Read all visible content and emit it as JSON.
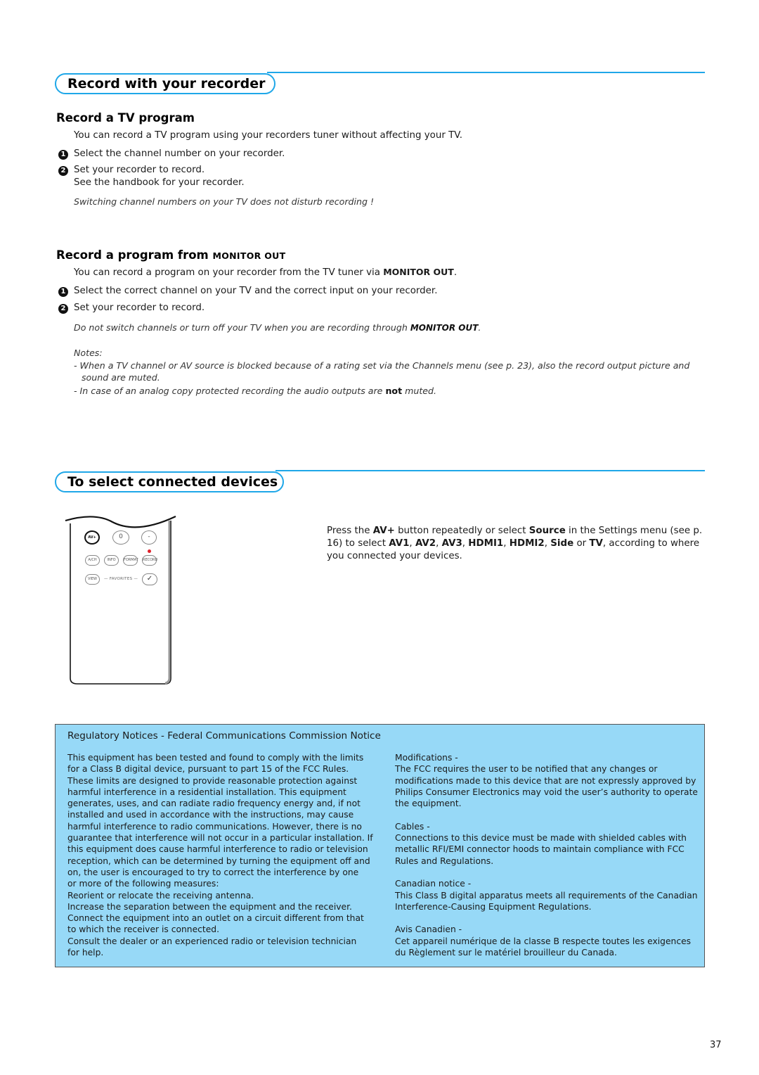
{
  "sections": {
    "record": {
      "title": "Record with your recorder",
      "tv_program": {
        "title": "Record a TV program",
        "intro": "You can record a TV program using your recorders tuner without affecting your TV.",
        "steps": [
          {
            "num": "1",
            "text": "Select the channel number on your recorder."
          },
          {
            "num": "2",
            "text": "Set your recorder to record.",
            "extra": "See the handbook for your recorder."
          }
        ],
        "note": "Switching channel numbers on your TV does not disturb recording !"
      },
      "monitor_out": {
        "title_prefix": "Record a program from",
        "title_emph": "MONITOR OUT",
        "intro_prefix": "You can record a program on your recorder from the TV tuner via",
        "intro_emph": "MONITOR OUT",
        "intro_suffix": ".",
        "steps": [
          {
            "num": "1",
            "text": "Select the correct channel on your TV and the correct input on your recorder."
          },
          {
            "num": "2",
            "text": "Set your recorder to record."
          }
        ],
        "warning_prefix": "Do not switch channels or turn off your TV when you are recording through",
        "warning_emph": "MONITOR OUT",
        "warning_suffix": ".",
        "notes_label": "Notes:",
        "notes": [
          {
            "line1": "- When a TV channel or AV source is blocked because of a rating set via the Channels menu (see p. 23), also the record output picture and",
            "line2": "sound are muted."
          },
          {
            "prefix": "- In case of an analog copy protected recording the audio outputs are",
            "emph": "not",
            "suffix": "muted."
          }
        ]
      }
    },
    "devices": {
      "title": "To select connected devices",
      "desc": {
        "l1_a": "Press the",
        "l1_b": "AV+",
        "l1_c": "button repeatedly or select",
        "l1_d": "Source",
        "l1_e": "in the Settings menu (see p.",
        "l2_a": "16) to select",
        "l2_b": "AV1",
        "l2_c": ",",
        "l2_d": "AV2",
        "l2_e": ",",
        "l2_f": "AV3",
        "l2_g": ",",
        "l2_h": "HDMI1",
        "l2_i": ",",
        "l2_j": "HDMI2",
        "l2_k": ",",
        "l2_l": "Side",
        "l2_m": "or",
        "l2_n": "TV",
        "l2_o": ", according to where",
        "l3": "you connected your devices."
      },
      "remote": {
        "buttons": {
          "av": "AV+",
          "zero": "0",
          "dash": "-",
          "ach": "A/CH",
          "info": "INFO",
          "format": "FORMAT",
          "record": "RECORD",
          "view": "VIEW",
          "check": "✓"
        },
        "favorites": "— FAVORITES —",
        "record_led_color": "#e0202a"
      }
    }
  },
  "regulatory": {
    "title": "Regulatory Notices - Federal Communications Commission Notice",
    "left": [
      "This equipment has been tested and found to comply with the limits",
      "for a Class B digital device, pursuant to part 15 of the FCC Rules.",
      "These limits are designed to provide reasonable protection against",
      "harmful interference in a residential installation. This equipment",
      "generates, uses, and can radiate radio frequency energy and, if not",
      "installed and used in accordance with the instructions, may cause",
      "harmful interference to radio communications. However, there is no",
      "guarantee that interference will not occur in a particular installation. If",
      "this equipment does cause harmful interference to radio or television",
      "reception, which can be determined by turning the equipment off and",
      "on, the user is encouraged to try to correct the interference by one",
      "or more of the following measures:",
      "Reorient or relocate the receiving antenna.",
      "Increase the separation between the equipment and the receiver.",
      "Connect the equipment into an outlet on a circuit different from that",
      "to which the receiver is connected.",
      "Consult the dealer or an experienced radio or television technician",
      "for help."
    ],
    "right": {
      "modifications_label": "Modifications -",
      "modifications": [
        "The FCC requires the user to be notified that any changes or",
        "modifications made to this device that are not expressly approved by",
        "Philips Consumer Electronics may void the user’s authority to operate",
        "the equipment."
      ],
      "cables_label": "Cables -",
      "cables": [
        "Connections to this device must be made with shielded cables with",
        "metallic RFI/EMI connector hoods to maintain compliance with FCC",
        "Rules and Regulations."
      ],
      "canadian_label": "Canadian notice -",
      "canadian": [
        "This Class B digital apparatus meets all requirements of the Canadian",
        "Interference-Causing Equipment Regulations."
      ],
      "avis_label": "Avis Canadien -",
      "avis": [
        "Cet appareil numérique de la classe B respecte toutes les exigences",
        "du Règlement sur le matériel brouilleur du Canada."
      ]
    }
  },
  "page_number": "37",
  "colors": {
    "accent": "#1fa7e8",
    "box_bg": "#97d9f7"
  }
}
